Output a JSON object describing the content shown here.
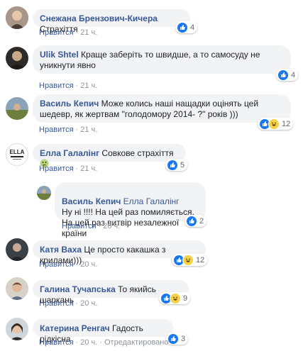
{
  "labels": {
    "like": "Нравится",
    "edited": "Отредактировано"
  },
  "comments": [
    {
      "name": "Снежана Брензович-Кичера",
      "text": "Страхіття",
      "time": "21 ч.",
      "count": "4"
    },
    {
      "name": "Ulik Shtel",
      "text": "Краще заберіть то швидше, а то самосуду не уникнути явно",
      "time": "21 ч.",
      "count": "4"
    },
    {
      "name": "Василь Кепич",
      "text": "Може колись наші нащадки оцінять цей шедевр, як жертвам \"голодомору 2014- ?\" років )))",
      "time": "21 ч.",
      "count": "12"
    },
    {
      "name": "Елла Галалінг",
      "text": "Совкове страхіття",
      "time": "21 ч.",
      "count": "5",
      "avatar_text": "ELLA"
    },
    {
      "name": "Василь Кепич",
      "mention": "Елла Галалінг",
      "text": "Ну ні !!!! На цей раз помиляється.\nНа цей раз витвір незалежної країни",
      "time": "20 ч.",
      "count": "2"
    },
    {
      "name": "Катя Ваха",
      "text": "Це просто какашка з крилами)))",
      "time": "20 ч.",
      "count": "12"
    },
    {
      "name": "Галина Тучапська",
      "text": "То якийсь шаркань",
      "time": "20 ч.",
      "count": "9"
    },
    {
      "name": "Катерина Ренгач",
      "text": "Гадость рідкісна",
      "time": "20 ч.",
      "count": "3"
    }
  ],
  "colors": {
    "link": "#385898",
    "bubble": "#f2f3f5",
    "meta": "#90949c"
  }
}
